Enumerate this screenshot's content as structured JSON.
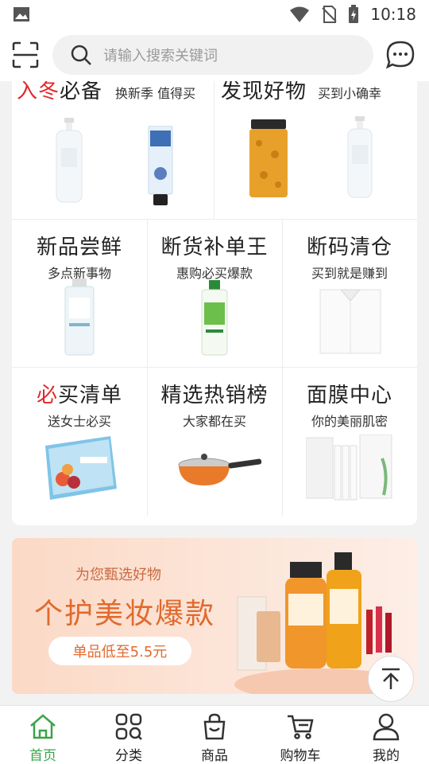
{
  "status_bar": {
    "time": "10:18"
  },
  "search": {
    "placeholder": "请输入搜索关键词"
  },
  "top_cells": [
    {
      "title_accent": "入冬",
      "title_rest": "必备",
      "subtitle": "换新季 值得买"
    },
    {
      "title_accent": "",
      "title_rest": "发现好物",
      "subtitle": "买到小确幸"
    }
  ],
  "grid": [
    {
      "title_accent": "",
      "title_rest": "新品尝鲜",
      "subtitle": "多点新事物"
    },
    {
      "title_accent": "",
      "title_rest": "断货补单王",
      "subtitle": "惠购必买爆款"
    },
    {
      "title_accent": "",
      "title_rest": "断码清仓",
      "subtitle": "买到就是赚到"
    },
    {
      "title_accent": "必",
      "title_rest": "买清单",
      "subtitle": "送女士必买"
    },
    {
      "title_accent": "",
      "title_rest": "精选热销榜",
      "subtitle": "大家都在买"
    },
    {
      "title_accent": "",
      "title_rest": "面膜中心",
      "subtitle": "你的美丽肌密"
    }
  ],
  "banner": {
    "kicker": "为您甄选好物",
    "title": "个护美妆爆款",
    "pill": "单品低至5.5元"
  },
  "bottom_nav": [
    {
      "label": "首页",
      "icon": "home-icon",
      "active": true
    },
    {
      "label": "分类",
      "icon": "category-icon",
      "active": false
    },
    {
      "label": "商品",
      "icon": "shopping-bag-icon",
      "active": false
    },
    {
      "label": "购物车",
      "icon": "cart-icon",
      "active": false
    },
    {
      "label": "我的",
      "icon": "profile-icon",
      "active": false
    }
  ],
  "colors": {
    "accent_red": "#e0282c",
    "nav_active": "#3aa44a",
    "banner_orange": "#e06a2e"
  }
}
